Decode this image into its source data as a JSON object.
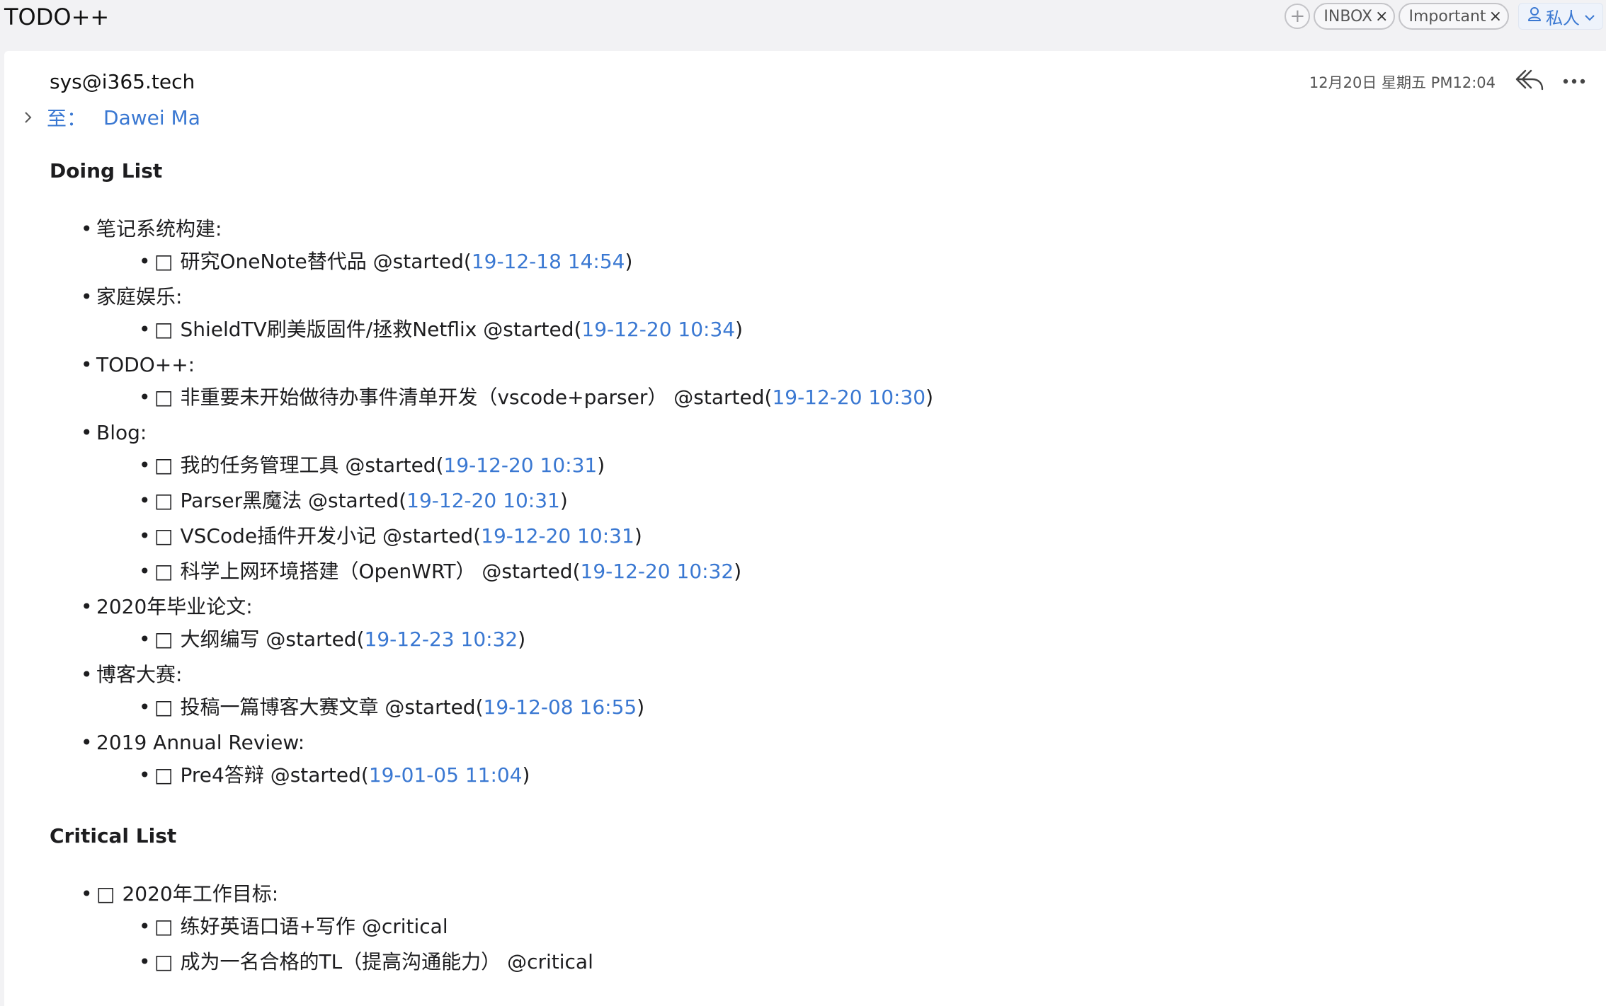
{
  "app": {
    "title": "TODO++"
  },
  "toolbar": {
    "add_symbol": "+",
    "tags": [
      {
        "label": "INBOX",
        "close": "×"
      },
      {
        "label": "Important",
        "close": "×"
      }
    ],
    "private_label": "私人"
  },
  "email": {
    "sender": "sys@i365.tech",
    "to_label": "至：",
    "to_name": "Dawei Ma",
    "date": "12月20日 星期五 PM12:04"
  },
  "checkbox_glyph": "□",
  "doing": {
    "heading": "Doing List",
    "groups": [
      {
        "label": "笔记系统构建:",
        "items": [
          {
            "text": "研究OneNote替代品 @started(",
            "ts": "19-12-18 14:54",
            "close": ")"
          }
        ]
      },
      {
        "label": "家庭娱乐:",
        "items": [
          {
            "text": "ShieldTV刷美版固件/拯救Netflix @started(",
            "ts": "19-12-20 10:34",
            "close": ")"
          }
        ]
      },
      {
        "label": "TODO++:",
        "items": [
          {
            "text": "非重要未开始做待办事件清单开发（vscode+parser） @started(",
            "ts": "19-12-20 10:30",
            "close": ")"
          }
        ]
      },
      {
        "label": "Blog:",
        "items": [
          {
            "text": "我的任务管理工具 @started(",
            "ts": "19-12-20 10:31",
            "close": ")"
          },
          {
            "text": "Parser黑魔法 @started(",
            "ts": "19-12-20 10:31",
            "close": ")"
          },
          {
            "text": "VSCode插件开发小记 @started(",
            "ts": "19-12-20 10:31",
            "close": ")"
          },
          {
            "text": "科学上网环境搭建（OpenWRT） @started(",
            "ts": "19-12-20 10:32",
            "close": ")"
          }
        ]
      },
      {
        "label": "2020年毕业论文:",
        "items": [
          {
            "text": "大纲编写 @started(",
            "ts": "19-12-23 10:32",
            "close": ")"
          }
        ]
      },
      {
        "label": "博客大赛:",
        "items": [
          {
            "text": "投稿一篇博客大赛文章 @started(",
            "ts": "19-12-08 16:55",
            "close": ")"
          }
        ]
      },
      {
        "label": "2019 Annual Review:",
        "items": [
          {
            "text": "Pre4答辩 @started(",
            "ts": "19-01-05 11:04",
            "close": ")"
          }
        ]
      }
    ]
  },
  "critical": {
    "heading": "Critical List",
    "groups": [
      {
        "label": "2020年工作目标:",
        "items": [
          {
            "text": "练好英语口语+写作 @critical"
          },
          {
            "text": "成为一名合格的TL（提高沟通能力） @critical"
          }
        ]
      }
    ]
  },
  "colors": {
    "accent": "#3a78d2",
    "text": "#1d1d1f",
    "background": "#f2f2f4",
    "card": "#ffffff"
  }
}
